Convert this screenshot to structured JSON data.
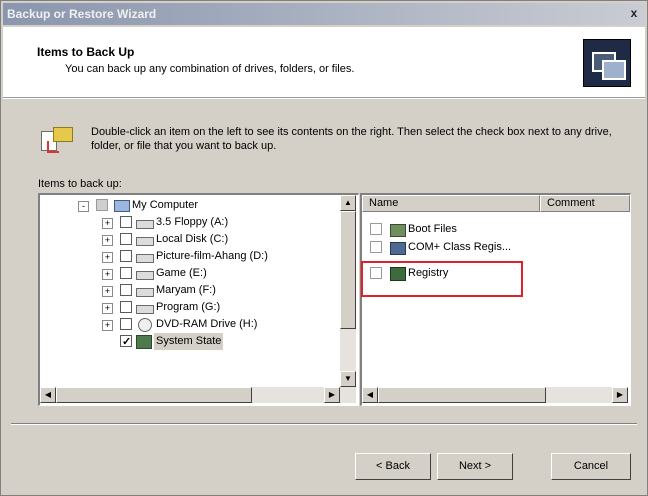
{
  "window": {
    "title": "Backup or Restore Wizard",
    "close_glyph": "x"
  },
  "header": {
    "title": "Items to Back Up",
    "subtitle": "You can back up any combination of drives, folders, or files."
  },
  "instructions": "Double-click an item on the left to see its contents on the right. Then select the check box next to any drive, folder, or file that you want to back up.",
  "tree_label": "Items to back up:",
  "tree": [
    {
      "label": "My Computer",
      "icon": "computer-icon",
      "checkbox": "indeterminate",
      "expander": "-"
    },
    {
      "label": "3.5 Floppy (A:)",
      "icon": "floppy-drive-icon",
      "checkbox": "unchecked",
      "expander": "+"
    },
    {
      "label": "Local Disk (C:)",
      "icon": "hard-drive-icon",
      "checkbox": "unchecked",
      "expander": "+"
    },
    {
      "label": "Picture-film-Ahang (D:)",
      "icon": "hard-drive-icon",
      "checkbox": "unchecked",
      "expander": "+"
    },
    {
      "label": "Game (E:)",
      "icon": "hard-drive-icon",
      "checkbox": "unchecked",
      "expander": "+"
    },
    {
      "label": "Maryam (F:)",
      "icon": "hard-drive-icon",
      "checkbox": "unchecked",
      "expander": "+"
    },
    {
      "label": "Program (G:)",
      "icon": "hard-drive-icon",
      "checkbox": "unchecked",
      "expander": "+"
    },
    {
      "label": "DVD-RAM Drive (H:)",
      "icon": "dvd-drive-icon",
      "checkbox": "unchecked",
      "expander": "+"
    },
    {
      "label": "System State",
      "icon": "system-state-icon",
      "checkbox": "checked",
      "expander": "",
      "selected": true
    }
  ],
  "list": {
    "columns": [
      "Name",
      "Comment"
    ],
    "items": [
      {
        "name": "Boot Files",
        "icon": "boot-files-icon",
        "checkbox": "unchecked"
      },
      {
        "name": "COM+ Class Regis...",
        "icon": "com-registration-icon",
        "checkbox": "unchecked"
      },
      {
        "name": "Registry",
        "icon": "registry-icon",
        "checkbox": "unchecked",
        "highlighted": true
      }
    ]
  },
  "buttons": {
    "back": "< Back",
    "next": "Next >",
    "cancel": "Cancel"
  },
  "colors": {
    "highlight_box": "#e0202a",
    "dialog_bg": "#d4d0c8"
  }
}
